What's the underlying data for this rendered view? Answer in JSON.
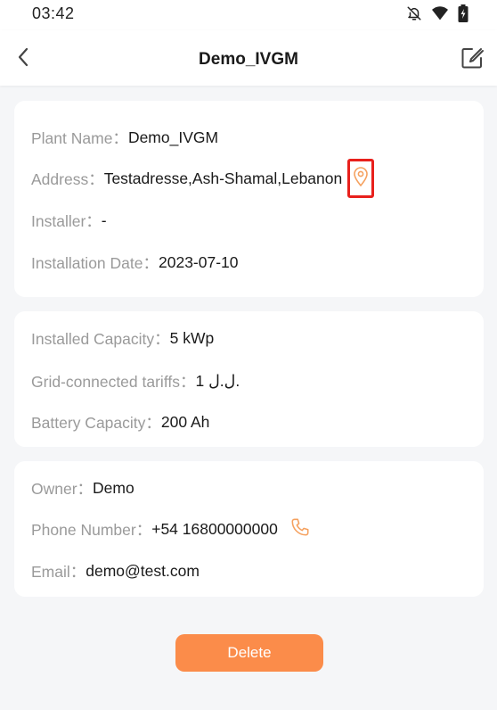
{
  "status_bar": {
    "time": "03:42",
    "icons": [
      "bell-off-icon",
      "wifi-icon",
      "battery-icon"
    ]
  },
  "header": {
    "title": "Demo_IVGM",
    "icons": [
      "back-arrow-icon",
      "edit-icon"
    ]
  },
  "plant_info": {
    "plant_name_label": "Plant Name：",
    "plant_name_value": "Demo_IVGM",
    "address_label": "Address：",
    "address_value": "Testadresse,Ash-Shamal,Lebanon",
    "installer_label": "Installer：",
    "installer_value": "-",
    "installation_date_label": "Installation Date：",
    "installation_date_value": "2023-07-10"
  },
  "capacity_info": {
    "installed_capacity_label": "Installed Capacity：",
    "installed_capacity_value": "5 kWp",
    "tariff_label": "Grid-connected tariffs：",
    "tariff_value": "1 ل.ل.",
    "battery_capacity_label": "Battery Capacity：",
    "battery_capacity_value": "200 Ah"
  },
  "owner_info": {
    "owner_label": "Owner：",
    "owner_value": "Demo",
    "phone_label": "Phone Number：",
    "phone_value": "+54 16800000000",
    "email_label": "Email：",
    "email_value": "demo@test.com"
  },
  "actions": {
    "delete_label": "Delete"
  },
  "colors": {
    "accent": "#fb8c4a",
    "highlight": "#e8201c",
    "label": "#9a9a9a",
    "background": "#f5f6f8"
  }
}
